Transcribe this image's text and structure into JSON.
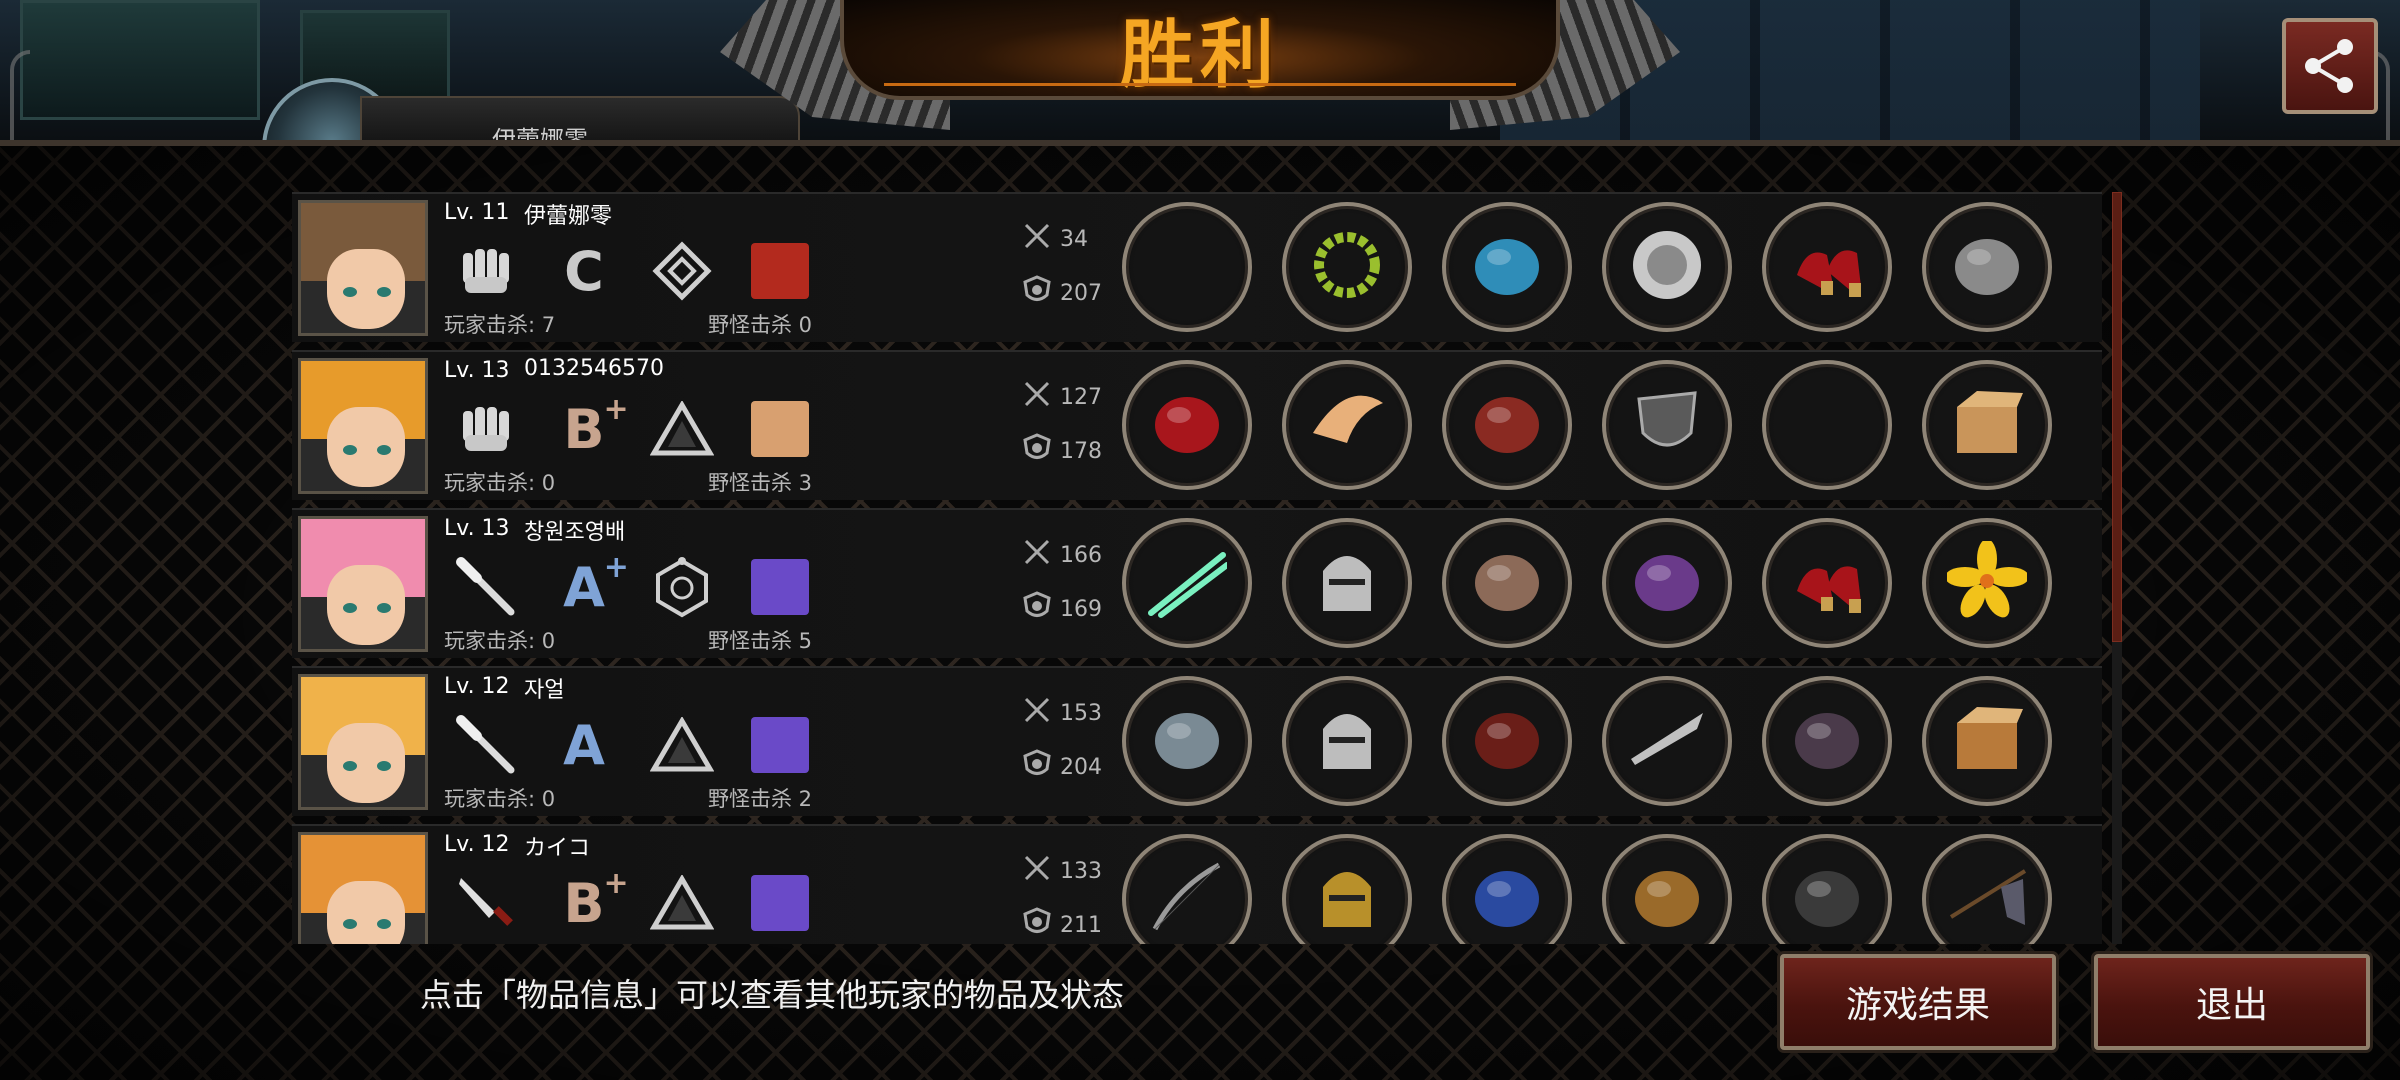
{
  "banner": {
    "title": "胜利"
  },
  "under_player": {
    "name": "伊蕾娜零"
  },
  "players": [
    {
      "level": "Lv. 11",
      "name": "伊蕾娜零",
      "weapon_icon": "fist-icon",
      "grade": "C",
      "grade_plus": "",
      "tier_icon": "diamond-tier-icon",
      "player_kills": "玩家击杀: 7",
      "monster_kills": "野怪击杀 0",
      "attack": "34",
      "defense": "207",
      "items": [
        "empty-slot",
        "laurel-wreath-icon",
        "blue-armor-icon",
        "steel-shield-icon",
        "red-heels-icon",
        "gray-armor-icon"
      ],
      "hair": "#7a5a3c"
    },
    {
      "level": "Lv. 13",
      "name": "0132546570",
      "weapon_icon": "fist-icon",
      "grade": "B",
      "grade_plus": "+",
      "tier_icon": "triangle-tier-icon",
      "player_kills": "玩家击杀: 0",
      "monster_kills": "野怪击杀 3",
      "attack": "127",
      "defense": "178",
      "items": [
        "red-mask-icon",
        "winged-tiara-icon",
        "red-gauntlet-armor-icon",
        "dark-shield-icon",
        "empty-slot",
        "cardboard-box-icon"
      ],
      "hair": "#e79b2b"
    },
    {
      "level": "Lv. 13",
      "name": "창원조영배",
      "weapon_icon": "bat-icon",
      "grade": "A",
      "grade_plus": "+",
      "tier_icon": "hexagon-tier-icon",
      "player_kills": "玩家击杀: 0",
      "monster_kills": "野怪击杀 5",
      "attack": "166",
      "defense": "169",
      "items": [
        "green-lightsaber-icon",
        "knight-helmet-icon",
        "leather-armor-icon",
        "purple-gauntlet-icon",
        "red-heels-icon",
        "yellow-lily-icon"
      ],
      "hair": "#f08cae"
    },
    {
      "level": "Lv. 12",
      "name": "자얼",
      "weapon_icon": "bat-icon",
      "grade": "A",
      "grade_plus": "",
      "tier_icon": "triangle-tier-icon",
      "player_kills": "玩家击杀: 0",
      "monster_kills": "野怪击杀 2",
      "attack": "153",
      "defense": "204",
      "items": [
        "gray-cloak-icon",
        "knight-helmet-icon",
        "red-armor-icon",
        "blade-bracer-icon",
        "dark-boots-icon",
        "cat-box-icon"
      ],
      "hair": "#f0b24a"
    },
    {
      "level": "Lv. 12",
      "name": "カイコ",
      "weapon_icon": "knife-icon",
      "grade": "B",
      "grade_plus": "+",
      "tier_icon": "triangle-tier-icon",
      "player_kills": "",
      "monster_kills": "",
      "attack": "133",
      "defense": "211",
      "items": [
        "bow-icon",
        "gold-helmet-icon",
        "blue-coat-icon",
        "gold-bracer-icon",
        "black-boots-icon",
        "spear-flag-icon"
      ],
      "hair": "#e59236"
    }
  ],
  "hint": "点击「物品信息」可以查看其他玩家的物品及状态",
  "buttons": {
    "result": "游戏结果",
    "exit": "退出"
  },
  "colors": {
    "accent": "#f5a623",
    "button_red": "#6e241c",
    "frame": "#8f8577"
  }
}
